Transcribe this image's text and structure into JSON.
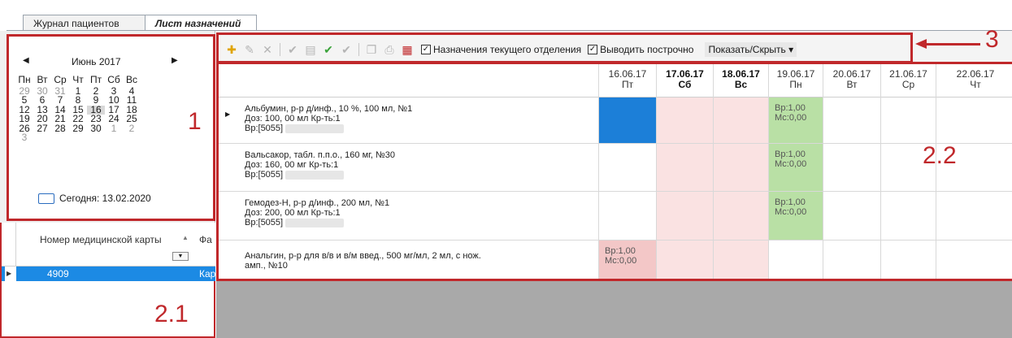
{
  "tabs": [
    {
      "label": "Журнал пациентов"
    },
    {
      "label": "Лист назначений"
    }
  ],
  "calendar": {
    "prev": "◀",
    "next": "▶",
    "month": "Июнь 2017",
    "weekdays": [
      "Пн",
      "Вт",
      "Ср",
      "Чт",
      "Пт",
      "Сб",
      "Вс"
    ],
    "days": [
      {
        "d": "29",
        "other": true
      },
      {
        "d": "30",
        "other": true
      },
      {
        "d": "31",
        "other": true
      },
      {
        "d": "1"
      },
      {
        "d": "2"
      },
      {
        "d": "3"
      },
      {
        "d": "4"
      },
      {
        "d": "5"
      },
      {
        "d": "6"
      },
      {
        "d": "7"
      },
      {
        "d": "8"
      },
      {
        "d": "9"
      },
      {
        "d": "10"
      },
      {
        "d": "11"
      },
      {
        "d": "12"
      },
      {
        "d": "13"
      },
      {
        "d": "14"
      },
      {
        "d": "15"
      },
      {
        "d": "16",
        "today": true
      },
      {
        "d": "17"
      },
      {
        "d": "18"
      },
      {
        "d": "19"
      },
      {
        "d": "20"
      },
      {
        "d": "21"
      },
      {
        "d": "22"
      },
      {
        "d": "23"
      },
      {
        "d": "24"
      },
      {
        "d": "25"
      },
      {
        "d": "26"
      },
      {
        "d": "27"
      },
      {
        "d": "28"
      },
      {
        "d": "29"
      },
      {
        "d": "30"
      },
      {
        "d": "1",
        "other": true
      },
      {
        "d": "2",
        "other": true
      },
      {
        "d": "3",
        "other": true
      }
    ],
    "today_label": "Сегодня: 13.02.2020"
  },
  "badges": {
    "b1": "1",
    "b21": "2.1",
    "b22": "2.2",
    "b3": "3"
  },
  "patients": {
    "col1": "Номер медицинской карты",
    "col2": "Фа",
    "sort_icon": "▲",
    "filter_icon": "▼",
    "row_arrow": "▶",
    "row": {
      "num": "4909",
      "next": "Кар"
    }
  },
  "toolbar": {
    "check1": "Назначения текущего отделения",
    "check2": "Выводить построчно",
    "dropdown": "Показать/Скрыть ▾",
    "check_mark": "✓",
    "icons": [
      {
        "name": "add-icon",
        "glyph": "✚",
        "color": "#e0a400"
      },
      {
        "name": "edit-icon",
        "glyph": "✎",
        "color": "#b5b5b5"
      },
      {
        "name": "delete-icon",
        "glyph": "✕",
        "color": "#b5b5b5"
      },
      {
        "name": "sep"
      },
      {
        "name": "confirm-icon",
        "glyph": "✔",
        "color": "#b5b5b5"
      },
      {
        "name": "document-icon",
        "glyph": "▤",
        "color": "#b5b5b5"
      },
      {
        "name": "check-list-icon",
        "glyph": "✔",
        "color": "#3aa33a"
      },
      {
        "name": "approve-icon",
        "glyph": "✔",
        "color": "#b5b5b5"
      },
      {
        "name": "sep"
      },
      {
        "name": "copy-icon",
        "glyph": "❐",
        "color": "#b5b5b5"
      },
      {
        "name": "print-icon",
        "glyph": "⎙",
        "color": "#b5b5b5"
      },
      {
        "name": "calendar-icon",
        "glyph": "▦",
        "color": "#c0282b"
      }
    ]
  },
  "grid": {
    "row_indicator": "▶",
    "dates": [
      {
        "date": "16.06.17",
        "dow": "Пт",
        "bold": false
      },
      {
        "date": "17.06.17",
        "dow": "Сб",
        "bold": true
      },
      {
        "date": "18.06.17",
        "dow": "Вс",
        "bold": true
      },
      {
        "date": "19.06.17",
        "dow": "Пн",
        "bold": false
      },
      {
        "date": "20.06.17",
        "dow": "Вт",
        "bold": false
      },
      {
        "date": "21.06.17",
        "dow": "Ср",
        "bold": false
      },
      {
        "date": "22.06.17",
        "dow": "Чт",
        "bold": false
      }
    ],
    "rows": [
      {
        "lines": [
          "Альбумин, р-р д/инф., 10 %, 100 мл, №1",
          "Доз: 100, 00 мл Кр-ть:1",
          "Вр:[5055]"
        ]
      },
      {
        "lines": [
          "Вальсакор, табл. п.п.о., 160 мг, №30",
          "Доз: 160, 00 мг Кр-ть:1",
          "Вр:[5055]"
        ]
      },
      {
        "lines": [
          "Гемодез-Н, р-р д/инф., 200 мл, №1",
          "Доз: 200, 00 мл Кр-ть:1",
          "Вр:[5055]"
        ]
      },
      {
        "lines": [
          "Анальгин, р-р для в/в и в/м введ., 500 мг/мл, 2 мл, с нож.",
          "амп., №10"
        ]
      }
    ],
    "cell_text": [
      "Вр:1,00",
      "Мс:0,00"
    ],
    "colors": {
      "selected": "#1c7fd8",
      "green": "#b9e0a5",
      "pink": "#f3c7c7",
      "weekend": "#fae2e2"
    }
  }
}
